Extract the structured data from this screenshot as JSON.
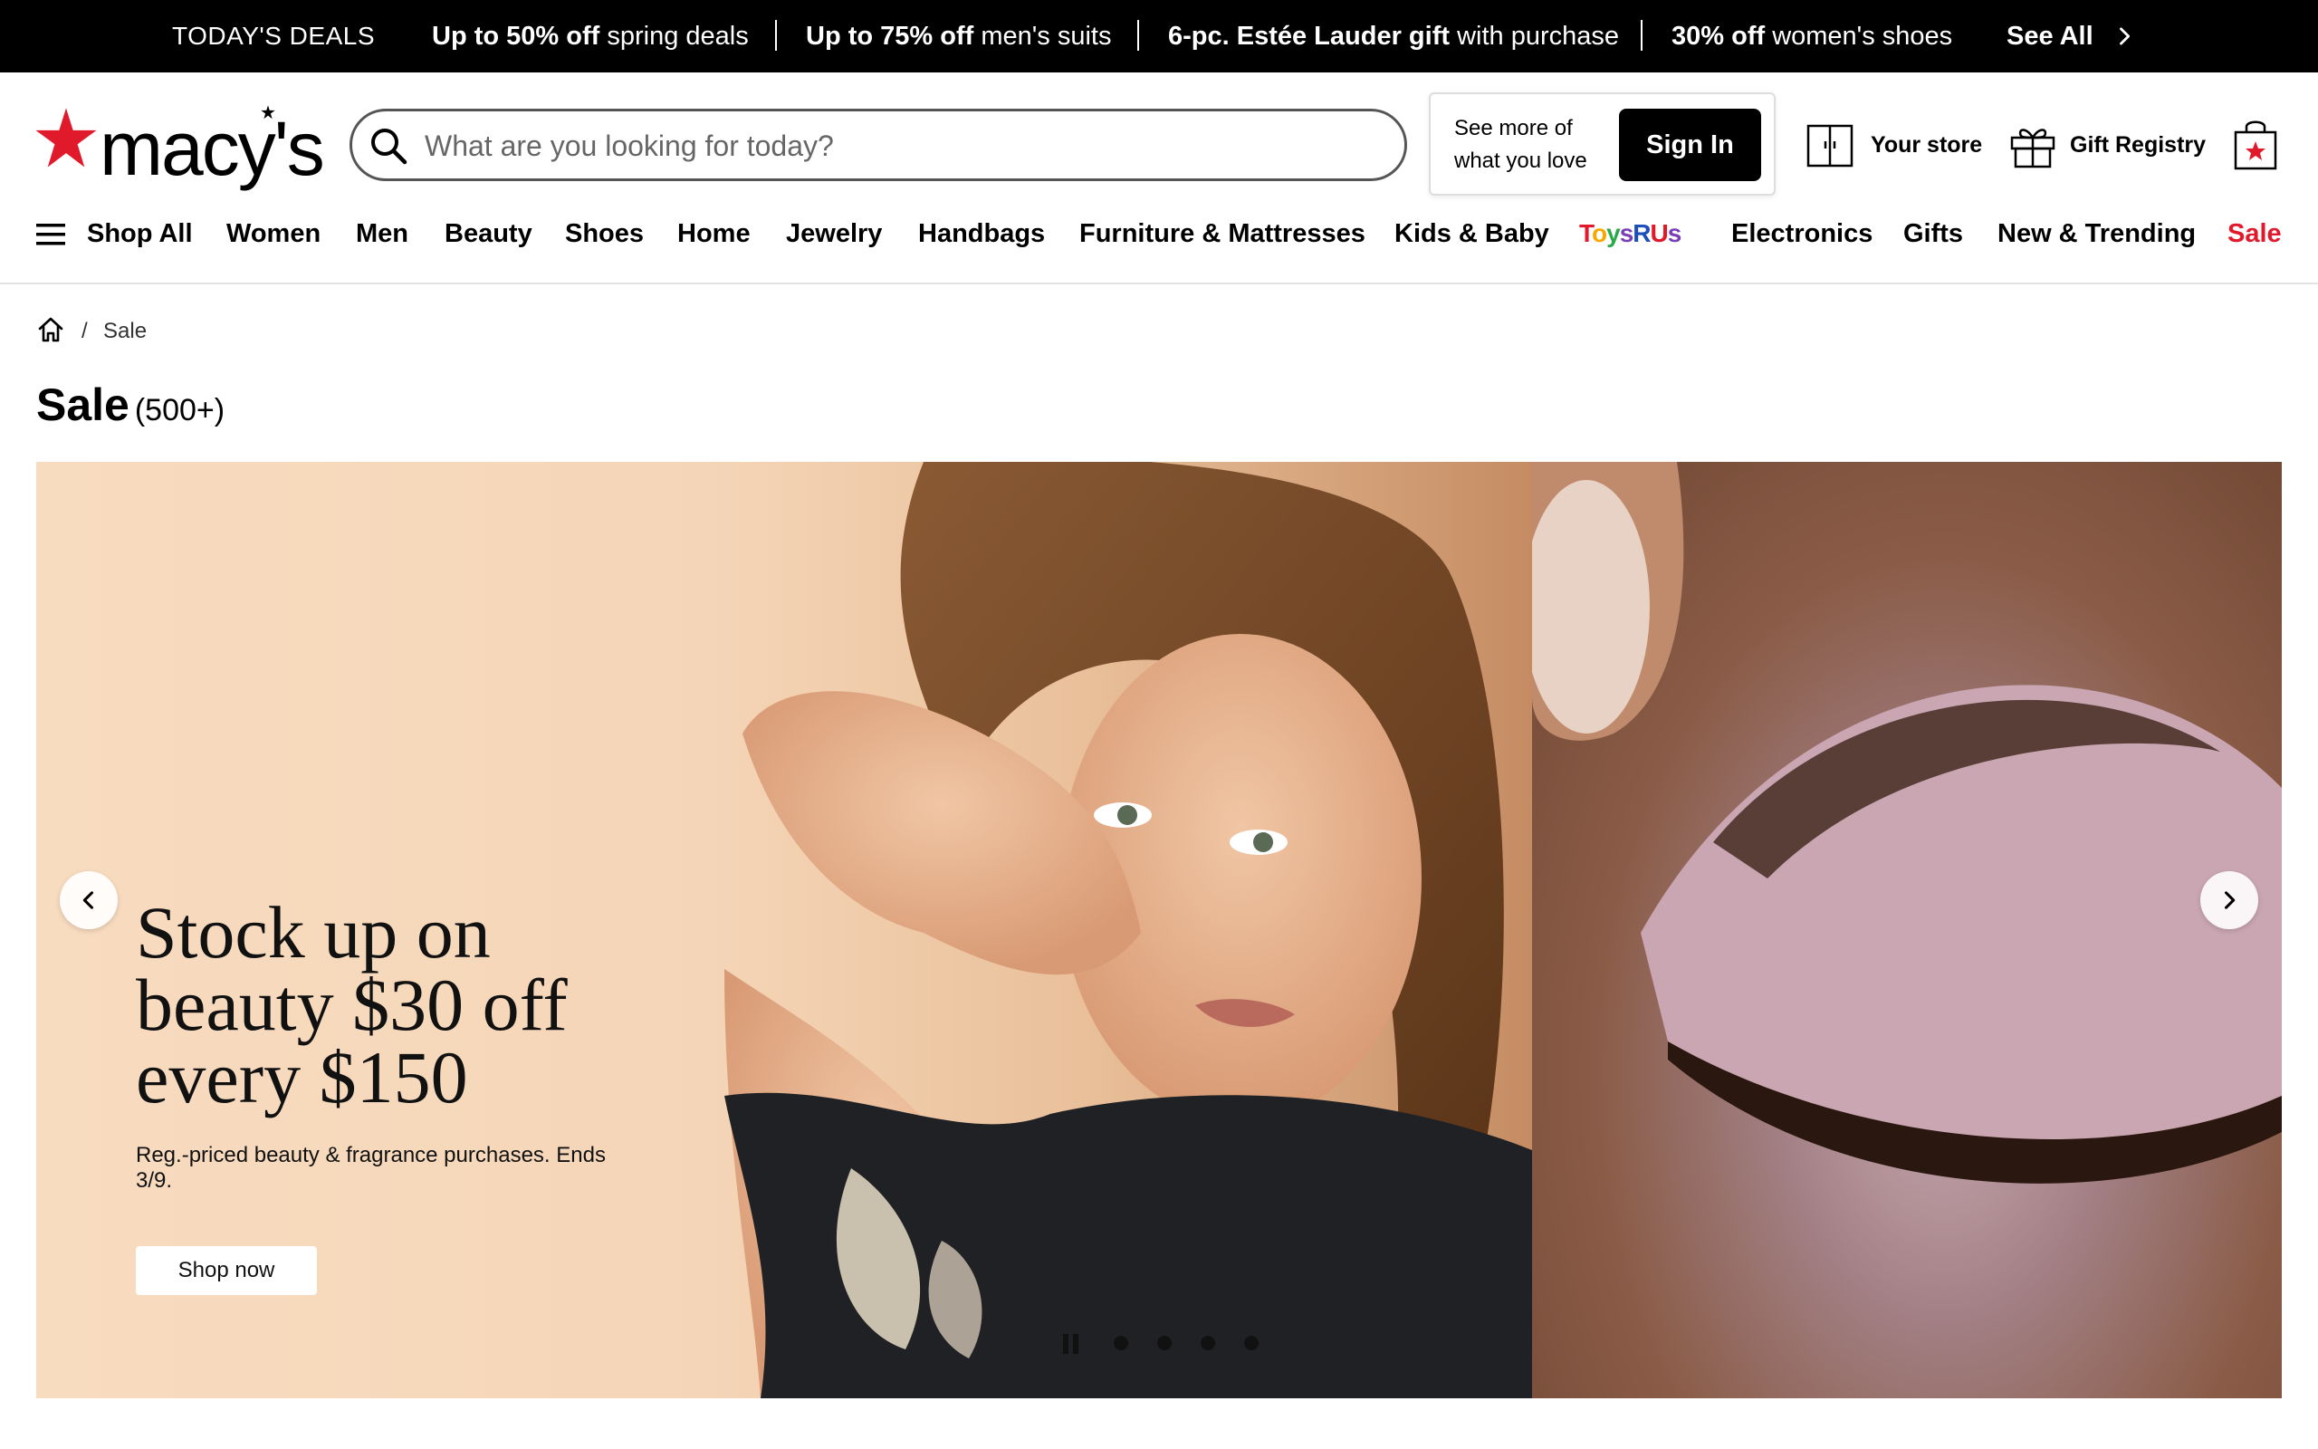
{
  "deals_bar": {
    "label": "TODAY'S DEALS",
    "deals": [
      {
        "bold": "Up to 50% off",
        "rest": " spring deals"
      },
      {
        "bold": "Up to 75% off",
        "rest": " men's suits"
      },
      {
        "bold": "6-pc. Estée Lauder gift",
        "rest": " with purchase"
      },
      {
        "bold": "30% off",
        "rest": " women's shoes"
      }
    ],
    "see_all": "See All"
  },
  "header": {
    "logo_text": "macy's",
    "search_placeholder": "What are you looking for today?",
    "signin_promo": "See more of what you love",
    "signin_label": "Sign In",
    "your_store": "Your store",
    "gift_registry": "Gift Registry"
  },
  "nav": {
    "items": [
      "Shop All",
      "Women",
      "Men",
      "Beauty",
      "Shoes",
      "Home",
      "Jewelry",
      "Handbags",
      "Furniture & Mattresses",
      "Kids & Baby",
      "Electronics",
      "Gifts",
      "New & Trending",
      "Sale"
    ],
    "toys_logo": "ToysRUs"
  },
  "breadcrumb": {
    "separator": "/",
    "current": "Sale"
  },
  "page": {
    "title": "Sale",
    "count": "(500+)"
  },
  "hero": {
    "headline": "Stock up on beauty $30 off every $150",
    "subtext": "Reg.-priced beauty & fragrance purchases. Ends 3/9.",
    "cta": "Shop now",
    "slide_count": 4
  },
  "colors": {
    "sale_red": "#e11a2b",
    "brand_red": "#e11a2b",
    "black": "#000000"
  }
}
